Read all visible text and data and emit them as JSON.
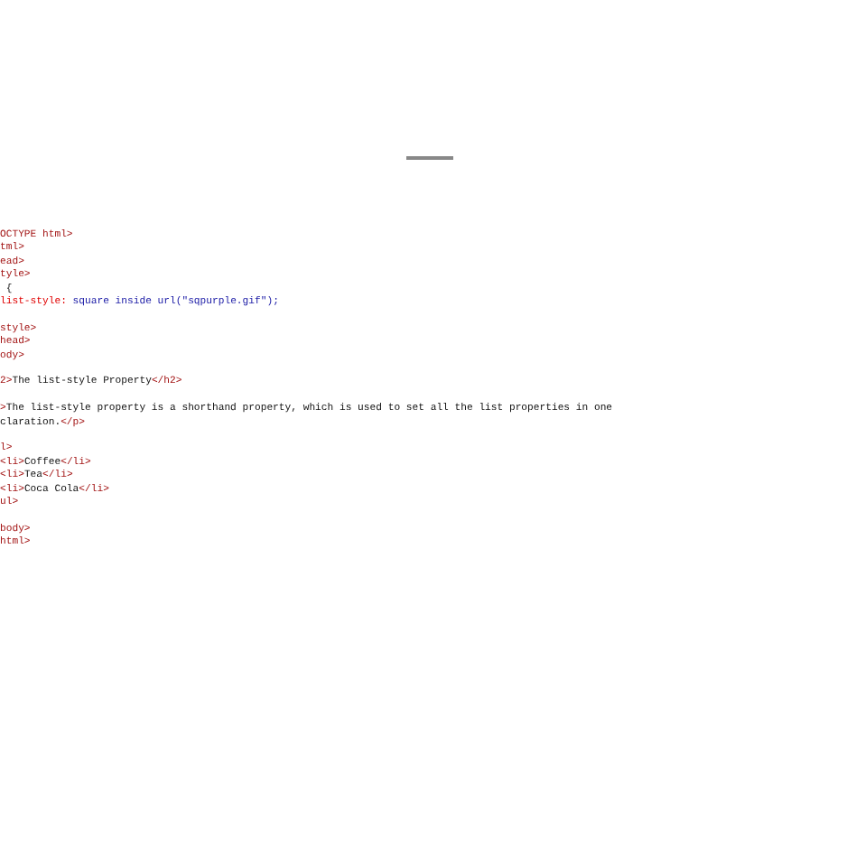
{
  "code_blocks": [
    [
      [
        {
          "kind": "tag",
          "text": "OCTYPE html>"
        }
      ],
      [
        {
          "kind": "tag",
          "text": "tml>"
        }
      ],
      [
        {
          "kind": "tag",
          "text": "ead>"
        }
      ],
      [
        {
          "kind": "tag",
          "text": "tyle>"
        }
      ],
      [
        {
          "kind": "text",
          "text": " {"
        }
      ],
      [
        {
          "kind": "prop",
          "text": "list-style:"
        },
        {
          "kind": "value",
          "text": " square inside url(\"sqpurple.gif\");"
        }
      ]
    ],
    [
      [
        {
          "kind": "tag",
          "text": "style>"
        }
      ],
      [
        {
          "kind": "tag",
          "text": "head>"
        }
      ],
      [
        {
          "kind": "tag",
          "text": "ody>"
        }
      ]
    ],
    [
      [
        {
          "kind": "tag",
          "text": "2>"
        },
        {
          "kind": "text",
          "text": "The list-style Property"
        },
        {
          "kind": "tag",
          "text": "</h2>"
        }
      ]
    ],
    [
      [
        {
          "kind": "tag",
          "text": ">"
        },
        {
          "kind": "text",
          "text": "The list-style property is a shorthand property, which is used to set all the list properties in one"
        }
      ],
      [
        {
          "kind": "text",
          "text": "claration."
        },
        {
          "kind": "tag",
          "text": "</p>"
        }
      ]
    ],
    [
      [
        {
          "kind": "tag",
          "text": "l>"
        }
      ],
      [
        {
          "kind": "tag",
          "text": "<li>"
        },
        {
          "kind": "text",
          "text": "Coffee"
        },
        {
          "kind": "tag",
          "text": "</li>"
        }
      ],
      [
        {
          "kind": "tag",
          "text": "<li>"
        },
        {
          "kind": "text",
          "text": "Tea"
        },
        {
          "kind": "tag",
          "text": "</li>"
        }
      ],
      [
        {
          "kind": "tag",
          "text": "<li>"
        },
        {
          "kind": "text",
          "text": "Coca Cola"
        },
        {
          "kind": "tag",
          "text": "</li>"
        }
      ],
      [
        {
          "kind": "tag",
          "text": "ul>"
        }
      ]
    ],
    [
      [
        {
          "kind": "tag",
          "text": "body>"
        }
      ],
      [
        {
          "kind": "tag",
          "text": "html>"
        }
      ]
    ]
  ]
}
